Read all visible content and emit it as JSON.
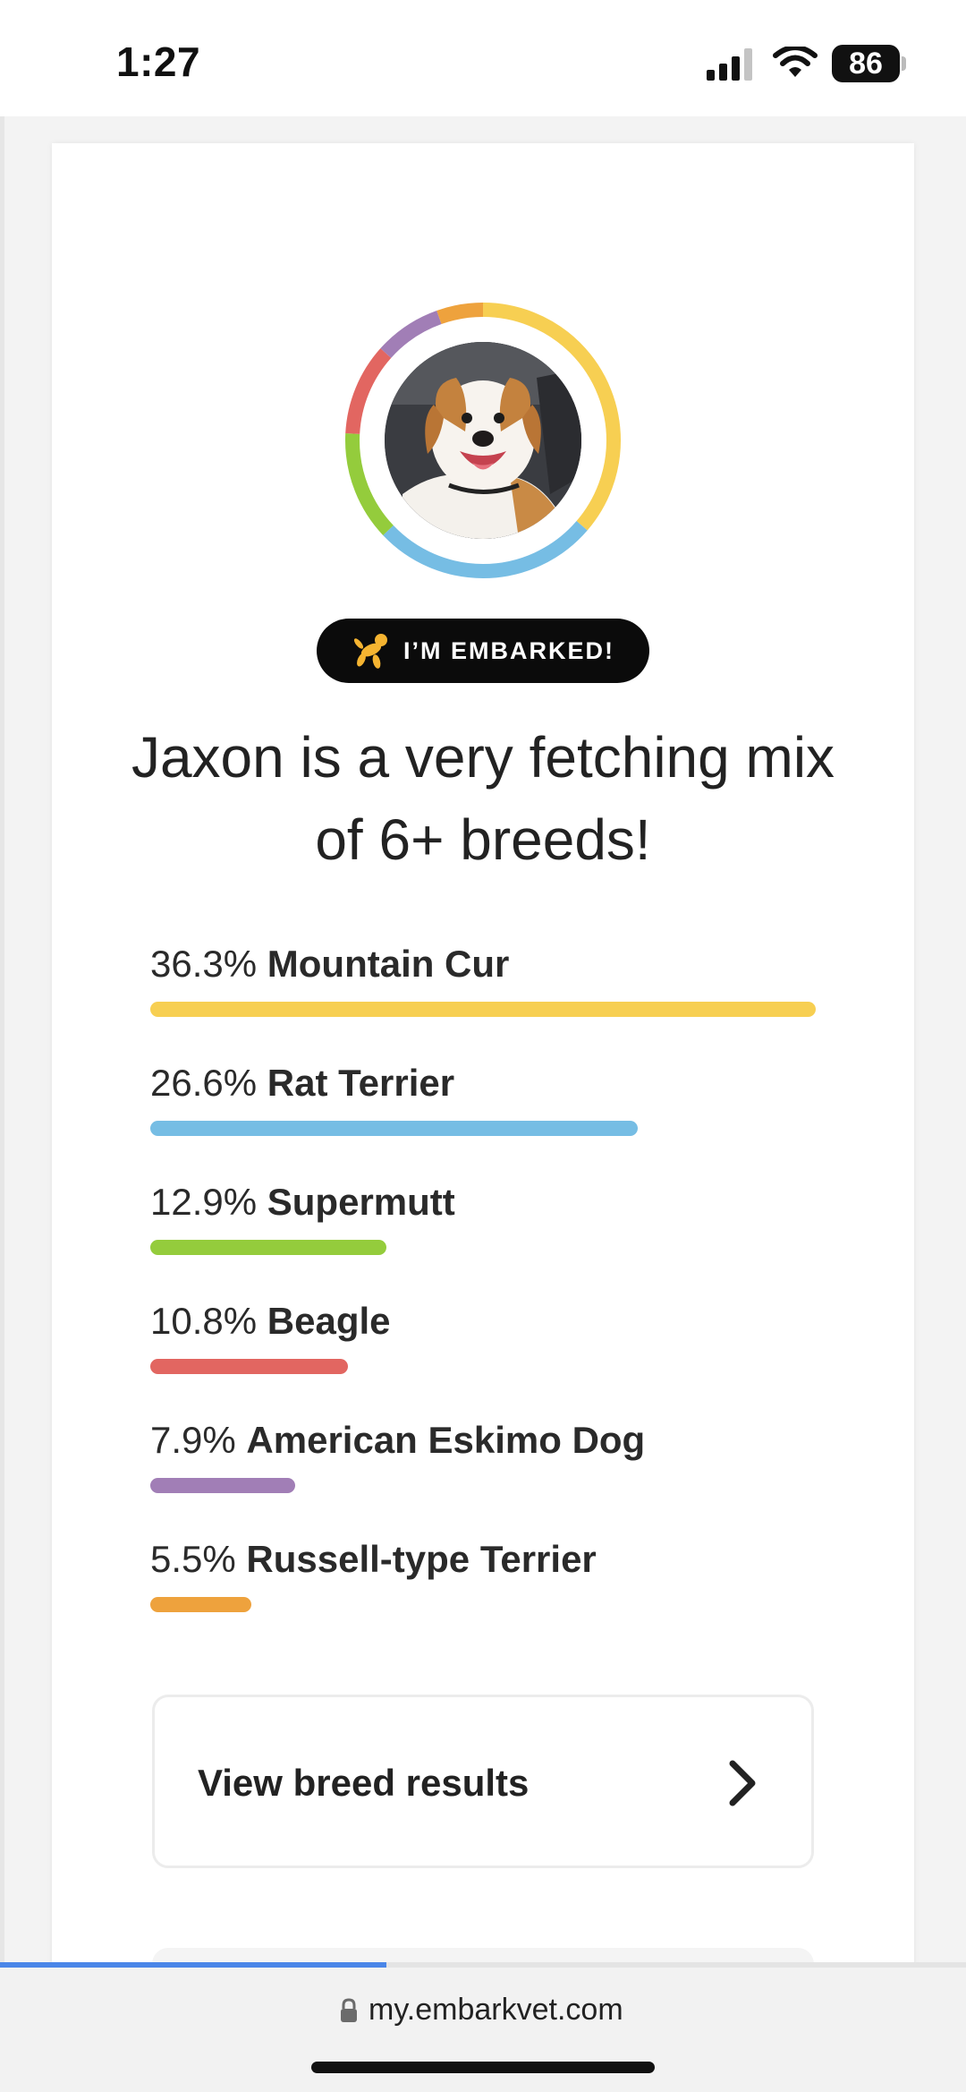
{
  "status_bar": {
    "time": "1:27",
    "battery": "86",
    "icons": [
      "signal-icon",
      "wifi-icon",
      "battery-icon"
    ]
  },
  "profile": {
    "ring_colors": [
      "#f7cf52",
      "#76bde4",
      "#94cc3c",
      "#e26661",
      "#a17eb6",
      "#eea23d"
    ],
    "badge_label": "I’M EMBARKED!",
    "badge_icon": "balloon-dog-icon",
    "headline": "Jaxon is a very fetching mix of 6+ breeds!"
  },
  "breeds": [
    {
      "percent": "36.3%",
      "name": "Mountain Cur",
      "value": 36.3,
      "color": "#f7cf52"
    },
    {
      "percent": "26.6%",
      "name": "Rat Terrier",
      "value": 26.6,
      "color": "#76bde4"
    },
    {
      "percent": "12.9%",
      "name": "Supermutt",
      "value": 12.9,
      "color": "#94cc3c"
    },
    {
      "percent": "10.8%",
      "name": "Beagle",
      "value": 10.8,
      "color": "#e26661"
    },
    {
      "percent": "7.9%",
      "name": "American Eskimo Dog",
      "value": 7.9,
      "color": "#a17eb6"
    },
    {
      "percent": "5.5%",
      "name": "Russell-type Terrier",
      "value": 5.5,
      "color": "#eea23d"
    }
  ],
  "actions": {
    "view_breed_results": "View breed results",
    "chevron_icon": "chevron-right-icon"
  },
  "browser": {
    "url": "my.embarkvet.com",
    "load_progress": 0.4,
    "progress_color": "#4a86e8"
  }
}
